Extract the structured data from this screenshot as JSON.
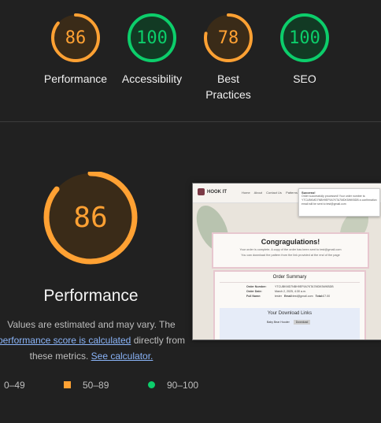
{
  "colors": {
    "average": "#ffa133",
    "pass": "#0cce6b",
    "average_bg": "#3a2b18",
    "pass_bg": "#123a24"
  },
  "gauges": [
    {
      "name": "performance",
      "score": "86",
      "label": "Performance",
      "value": 0.86,
      "status": "average"
    },
    {
      "name": "accessibility",
      "score": "100",
      "label": "Accessibility",
      "value": 1.0,
      "status": "pass"
    },
    {
      "name": "best-practices",
      "score": "78",
      "label_line1": "Best",
      "label_line2": "Practices",
      "value": 0.78,
      "status": "average"
    },
    {
      "name": "seo",
      "score": "100",
      "label": "SEO",
      "value": 1.0,
      "status": "pass"
    }
  ],
  "main": {
    "score": "86",
    "value": 0.86,
    "title": "Performance",
    "note_prefix": "Values are estimated and may vary. The",
    "note_link1": "performance score is calculated",
    "note_middle": "directly from",
    "note_line3": "these metrics.",
    "note_link2": "See calculator."
  },
  "legend": [
    {
      "range": "0–49",
      "icon": "triangle-fail-icon"
    },
    {
      "range": "50–89",
      "icon": "square-average-icon"
    },
    {
      "range": "90–100",
      "icon": "circle-pass-icon"
    }
  ],
  "screenshot": {
    "brand": "HOOK IT",
    "nav": [
      "Home",
      "About",
      "Contact Us",
      "Patterns",
      "Logout",
      "Profile"
    ],
    "popup_title": "Success!",
    "popup_text": "Order successfully processed! Your order number is: YTCUBKMD7NBH9EF9A7KTA7MDK5WKBDB a confirmation email will be sent to test@gmail.com",
    "congrats": "Congragulations!",
    "congrats_line1": "Your order is complete. A copy of the order has been sent to test@gmail.com",
    "congrats_line2": "You can download the pattern from the link provided at the end of the page",
    "summary_title": "Order Summary",
    "order_number_label": "Order Number:",
    "order_number": "YTCUBKMD7NBH9EF9A7KTA7MDK5WKBDB",
    "order_date_label": "Order Date:",
    "order_date": "March 2, 2025, 4:30 a.m.",
    "full_name_label": "Full Name:",
    "full_name": "tester",
    "email_label": "Email:",
    "email": "test@gmail.com",
    "total_label": "Total:",
    "total": "£7.00",
    "downloads_title": "Your Download Links",
    "download_item": "Baby Bear Hooder",
    "download_btn": "Download"
  }
}
